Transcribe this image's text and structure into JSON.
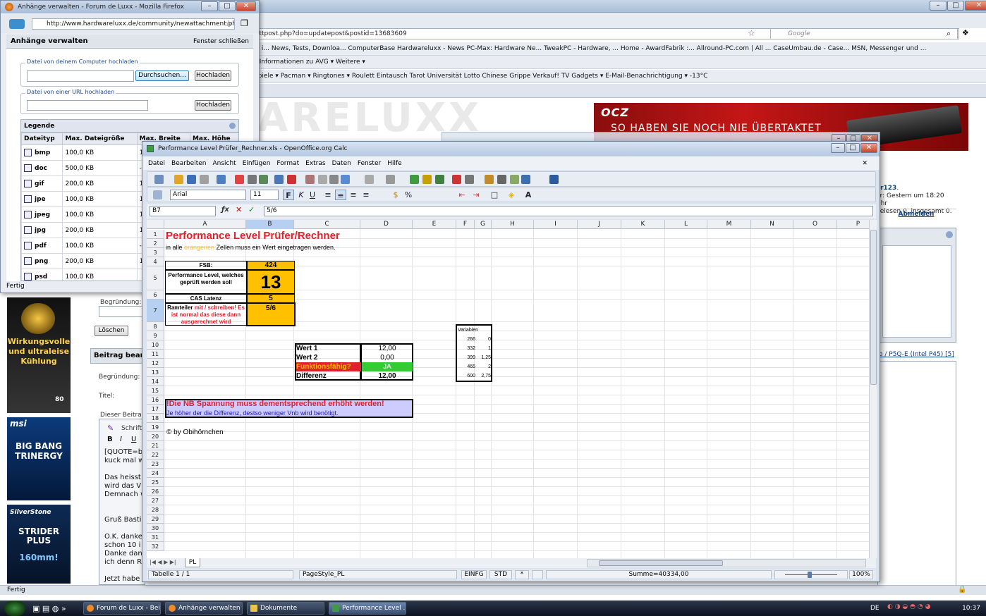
{
  "background_browser": {
    "url_fragment": "ittpost.php?do=updatepost&postid=13683609",
    "search_placeholder": "Google",
    "bookmarks_row1": "el i...   News, Tests, Downloa...   ComputerBase   Hardwareluxx - News   PC-Max: Hardware Ne...   TweakPC - Hardware, ...   Home - AwardFabrik :...   Allround-PC.com | All ...   CaseUmbau.de - Case...   MSN, Messenger und ...",
    "bookmarks_row2": "z  Informationen zu AVG ▾   Weitere ▾",
    "bookmarks_row3": "Spiele ▾   Pacman ▾   Ringtones ▾   Roulett   Eintausch   Tarot   Universität   Lotto   Chinese   Grippe      Verkauf!   TV   Gadgets ▾   E-Mail-Benachrichtigung ▾   -13°C",
    "logo_faded": "ARELUXX",
    "ad_banner": {
      "logo": "OCZ",
      "slogan": "SO HABEN SIE NOCH NIE ÜBERTAKTET"
    },
    "user_info": {
      "name": "ar123",
      "line1": "er: Gestern um 18:20 Uhr",
      "line2": "gelesen 0, insgesamt 0."
    },
    "logout_label": "Abmelden",
    "thread_link": "o / P5Q-E (Intel P45) [5]",
    "status": "Fertig",
    "left_ads": [
      {
        "brand": "",
        "text": "Wirkungsvolle und ultraleise Kühlung",
        "extra": "80"
      },
      {
        "brand": "msi",
        "text": "BIG BANG TRINERGY",
        "extra": ""
      },
      {
        "brand": "SilverStone",
        "text": "STRIDER PLUS",
        "extra": "160mm!"
      }
    ],
    "forum": {
      "begruendung_label": "Begründung:",
      "loeschen_label": "Löschen",
      "beitrag_head": "Beitrag bearb",
      "begruendung2_label": "Begründung:",
      "titel_label": "Titel:",
      "dieser_beitrag_label": "Dieser Beitrag",
      "schrift_label": "Schrifta",
      "editor_text": "[QUOTE=b\nkuck mal w\n\nDas heisst\nwird das V\nDemnach w\n\n\nGruß Basti\n\nO.K. danke\nschon 10 i\nDanke dan\nich denn R\n\nJetzt habe"
    }
  },
  "attachments_window": {
    "title": "Anhänge verwalten - Forum de Luxx - Mozilla Firefox",
    "url": "http://www.hardwareluxx.de/community/newattachment.php?p",
    "heading": "Anhänge verwalten",
    "close_link": "Fenster schließen",
    "upload_computer_legend": "Datei von deinem Computer hochladen",
    "browse_button": "Durchsuchen...",
    "upload_button": "Hochladen",
    "upload_url_legend": "Datei von einer URL hochladen",
    "upload_button2": "Hochladen",
    "legend_title": "Legende",
    "columns": [
      "Dateityp",
      "Max. Dateigröße",
      "Max. Breite",
      "Max. Höhe"
    ],
    "rows": [
      {
        "type": "bmp",
        "size": "100,0 KB",
        "w": "1",
        "h": ""
      },
      {
        "type": "doc",
        "size": "500,0 KB",
        "w": "-",
        "h": ""
      },
      {
        "type": "gif",
        "size": "200,0 KB",
        "w": "1",
        "h": ""
      },
      {
        "type": "jpe",
        "size": "100,0 KB",
        "w": "1",
        "h": ""
      },
      {
        "type": "jpeg",
        "size": "100,0 KB",
        "w": "1",
        "h": ""
      },
      {
        "type": "jpg",
        "size": "200,0 KB",
        "w": "1",
        "h": ""
      },
      {
        "type": "pdf",
        "size": "100,0 KB",
        "w": "-",
        "h": ""
      },
      {
        "type": "png",
        "size": "200,0 KB",
        "w": "1",
        "h": ""
      },
      {
        "type": "psd",
        "size": "100,0 KB",
        "w": "",
        "h": ""
      }
    ],
    "status": "Fertig"
  },
  "calc": {
    "title": "Performance Level Prüfer_Rechner.xls - OpenOffice.org Calc",
    "menu": [
      "Datei",
      "Bearbeiten",
      "Ansicht",
      "Einfügen",
      "Format",
      "Extras",
      "Daten",
      "Fenster",
      "Hilfe"
    ],
    "font_name": "Arial",
    "font_size": "11",
    "name_box": "B7",
    "formula": "5/6",
    "columns": [
      "A",
      "B",
      "C",
      "D",
      "E",
      "F",
      "G",
      "H",
      "I",
      "J",
      "K",
      "L",
      "M",
      "N",
      "O",
      "P"
    ],
    "rows": [
      "1",
      "2",
      "3",
      "4",
      "5",
      "6",
      "7",
      "8",
      "9",
      "10",
      "11",
      "12",
      "13",
      "14",
      "15",
      "16",
      "17",
      "18",
      "19",
      "20",
      "21",
      "22",
      "23",
      "24",
      "25",
      "26",
      "27",
      "28",
      "29",
      "30",
      "31",
      "32"
    ],
    "cells": {
      "title": "Performance Level Prüfer/Rechner",
      "subtitle_pre": "in alle ",
      "subtitle_orange": "orangenen",
      "subtitle_post": " Zellen muss ein Wert eingetragen werden.",
      "fsb_label": "FSB:",
      "fsb_value": "424",
      "pl_label": "Performance Level, welches geprüft werden soll",
      "pl_value": "13",
      "cas_label": "CAS Latenz",
      "cas_value": "5",
      "ram_label_a": "Ramteiler ",
      "ram_label_b": "mit / schreiben! Es ist normal das diese dann ausgerechnet wird",
      "ram_value": "5/6",
      "wert1_label": "Wert 1",
      "wert1_value": "12,00",
      "wert2_label": "Wert 2",
      "wert2_value": "0,00",
      "func_label": "Funktionsfähig?",
      "func_value": "JA",
      "diff_label": "Differenz",
      "diff_value": "12,00",
      "warning": "!Die NB Spannung muss dementsprechend erhöht werden!",
      "hint": "Je höher der die Differenz, destso weniger Vnb wird benötigt.",
      "copyright": "© by Obihörnchen",
      "variablen_label": "Variablen",
      "variablen": [
        [
          "266",
          "0"
        ],
        [
          "332",
          "1"
        ],
        [
          "399",
          "1,25"
        ],
        [
          "465",
          "2"
        ],
        [
          "600",
          "2,75"
        ]
      ]
    },
    "sheet_tab": "PL",
    "status": {
      "sheet": "Tabelle 1 / 1",
      "pagestyle": "PageStyle_PL",
      "mode1": "EINFG",
      "mode2": "STD",
      "mode3": "*",
      "sum": "Summe=40334,00",
      "zoom": "100%"
    }
  },
  "taskbar": {
    "tasks": [
      "Forum de Luxx - Bei...",
      "Anhänge verwalten ...",
      "Dokumente",
      "Performance Level ..."
    ],
    "lang": "DE",
    "clock": "10:37"
  },
  "colors": {
    "orange": "#ffc000",
    "green": "#33cc33",
    "title_red": "#e0202a",
    "warn_bg": "#ccccff"
  }
}
